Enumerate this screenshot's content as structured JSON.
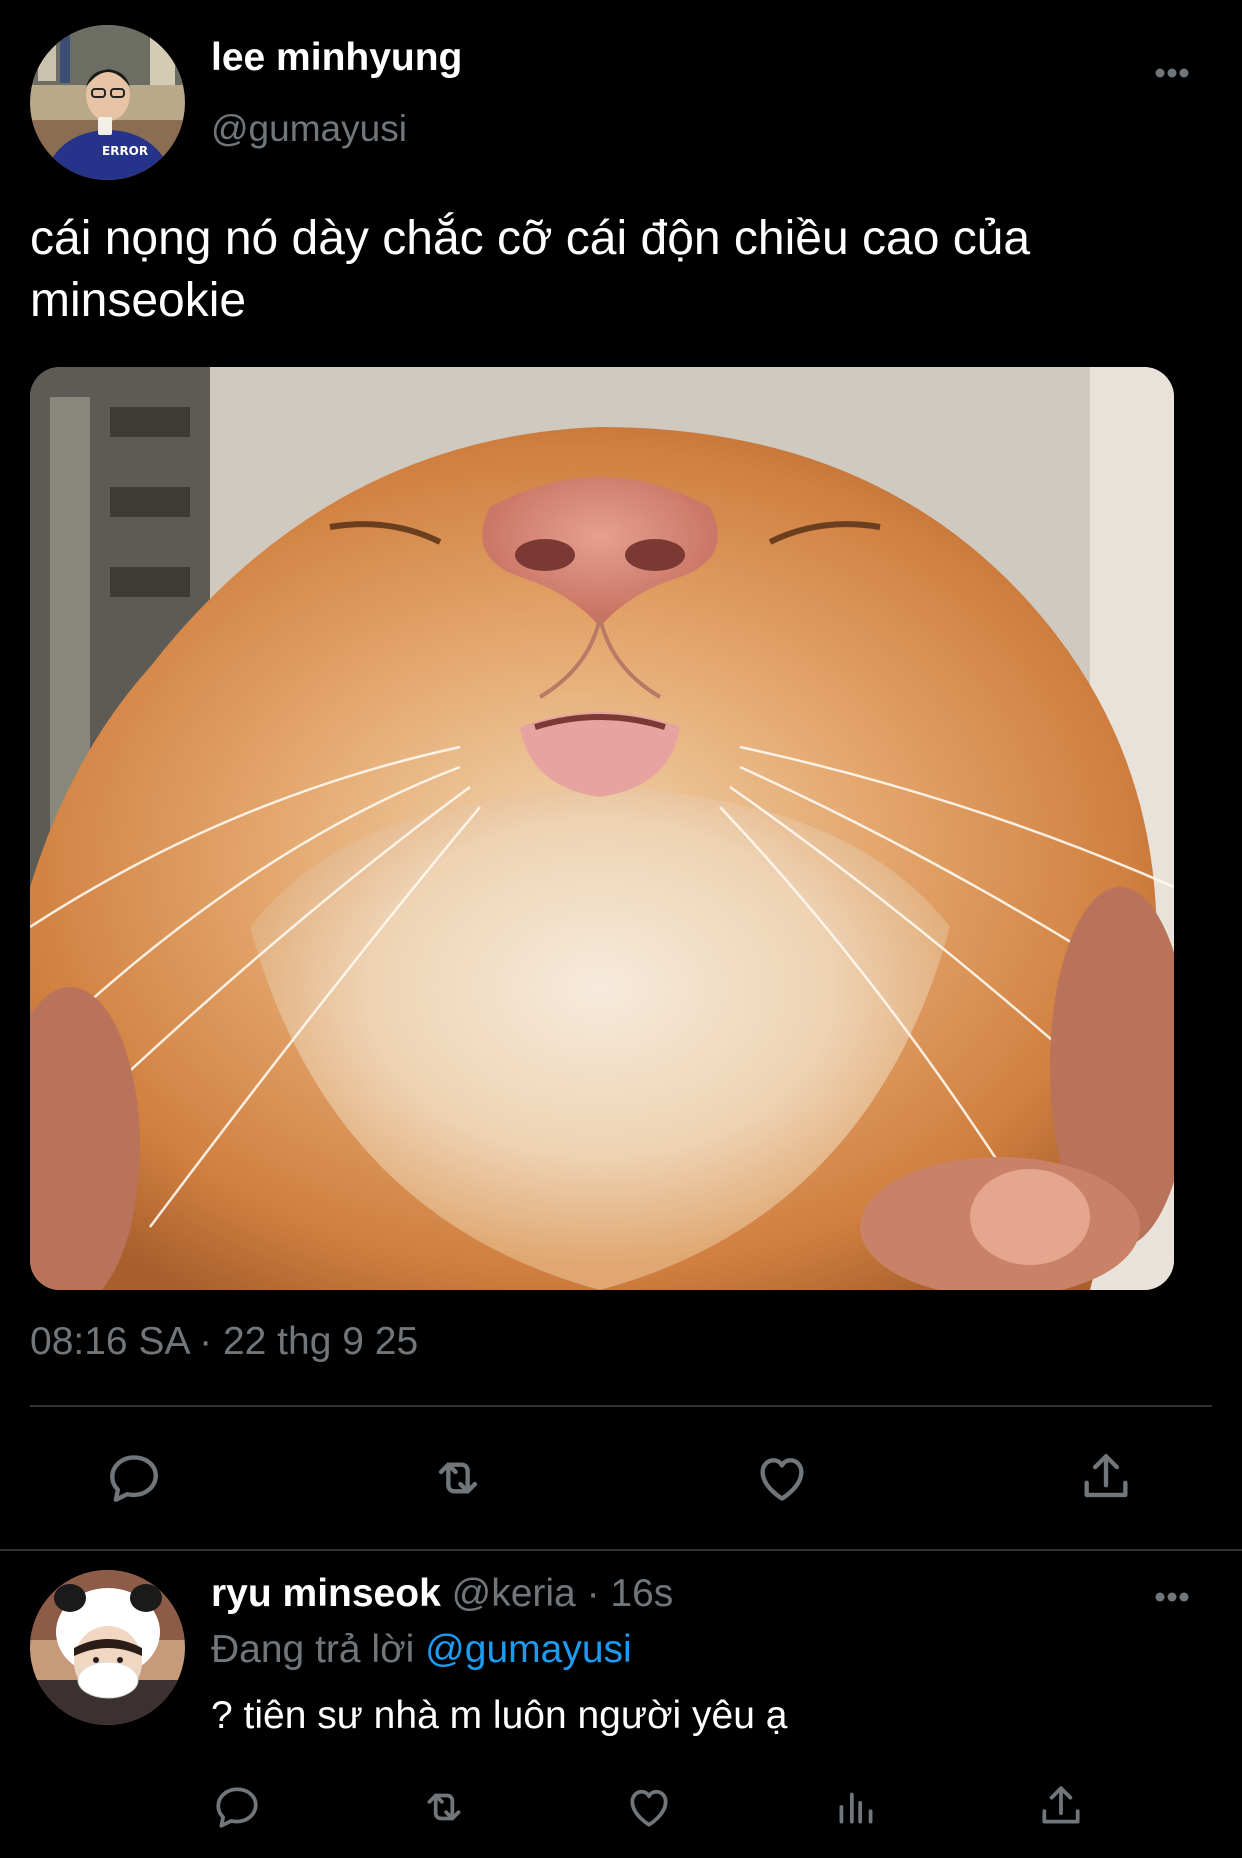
{
  "tweet": {
    "author_name": "lee minhyung",
    "author_handle": "@gumayusi",
    "text": "cái nọng nó dày chắc cỡ cái độn chiều cao của minseokie",
    "timestamp": "08:16 SA · 22 thg 9 25",
    "media_icon": "photo-orange-cat",
    "actions": [
      "reply-icon",
      "retweet-icon",
      "like-icon",
      "share-icon"
    ]
  },
  "reply": {
    "author_name": "ryu minseok",
    "author_handle": "@keria",
    "separator": " · ",
    "age": "16s",
    "replying_prefix": "Đang trả lời ",
    "replying_handle": "@gumayusi",
    "text": "? tiên sư nhà m luôn người yêu ạ",
    "actions": [
      "reply-icon",
      "retweet-icon",
      "like-icon",
      "analytics-icon",
      "share-icon"
    ]
  },
  "colors": {
    "background": "#000000",
    "text": "#ffffff",
    "secondary": "#71767b",
    "accent": "#1d9bf0",
    "divider": "#2f3336"
  }
}
